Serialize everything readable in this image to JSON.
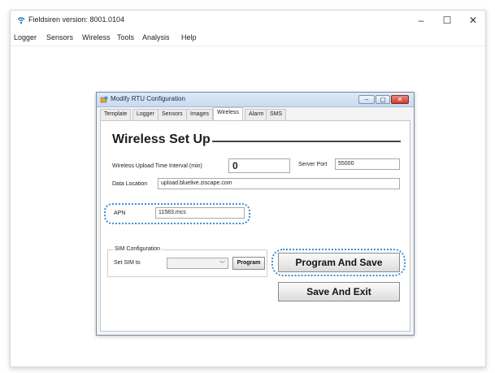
{
  "window": {
    "title": "Fieldsiren version: 8001.0104",
    "controls": {
      "minimize": "–",
      "maximize": "☐",
      "close": "✕"
    }
  },
  "menu": {
    "items": [
      "Logger",
      "Sensors",
      "Wireless",
      "Tools",
      "Analysis",
      "Help"
    ]
  },
  "dialog": {
    "title": "Modify RTU Configuration",
    "tabs": [
      "Template",
      "Logger",
      "Sensors",
      "Images",
      "Wireless",
      "Alarm",
      "SMS"
    ],
    "active_tab": "Wireless",
    "heading": "Wireless Set Up",
    "upload_interval_label": "Wireless Upload Time Interval (min)",
    "upload_interval_value": "0",
    "server_port_label": "Server Port",
    "server_port_value": "55000",
    "data_location_label": "Data Location",
    "data_location_value": "upload.bluelive.ziscape.com",
    "apn_label": "APN",
    "apn_value": "11583.mcs",
    "sim_group_label": "SIM Configuration",
    "set_sim_label": "Set SIM to",
    "set_sim_value": "",
    "program_button": "Program",
    "program_and_save_button": "Program And Save",
    "save_and_exit_button": "Save And Exit"
  },
  "colors": {
    "highlight_ring": "#3b8fd9",
    "close_button": "#c7402c"
  }
}
